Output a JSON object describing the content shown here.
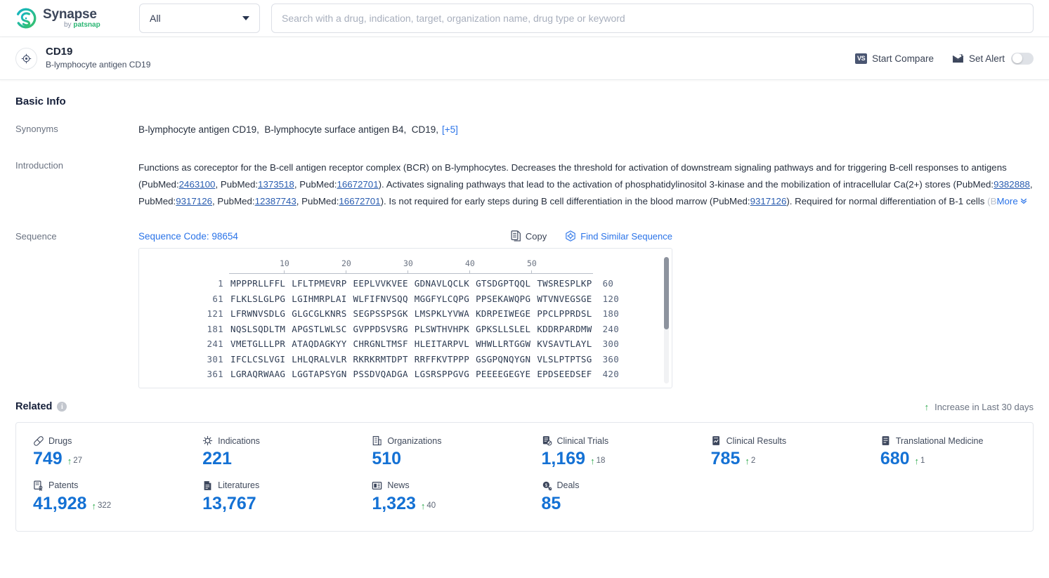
{
  "brand": {
    "name": "Synapse",
    "by_prefix": "by ",
    "by_name": "patsnap",
    "logo_icon": "synapse-circle-logo"
  },
  "search": {
    "scope_value": "All",
    "scope_caret_icon": "chevron-down-icon",
    "placeholder": "Search with a drug, indication, target, organization name, drug type or keyword",
    "value": ""
  },
  "entity": {
    "icon": "target-crosshair-icon",
    "name": "CD19",
    "alias": "B-lymphocyte antigen CD19",
    "actions": {
      "compare_badge": "VS",
      "compare_label": "Start Compare",
      "alert_icon": "alert-envelope-icon",
      "alert_label": "Set Alert",
      "alert_toggle_state": "off"
    }
  },
  "basic_info": {
    "title": "Basic Info",
    "synonyms": {
      "label": "Synonyms",
      "items": [
        "B-lymphocyte antigen CD19",
        "B-lymphocyte surface antigen B4",
        "CD19"
      ],
      "more": "[+5]"
    },
    "introduction": {
      "label": "Introduction",
      "text_1": "Functions as coreceptor for the B-cell antigen receptor complex (BCR) on B-lymphocytes. Decreases the threshold for activation of downstream signaling pathways and for triggering B-cell responses to antigens (PubMed:",
      "ref_1": "2463100",
      "text_2": ", PubMed:",
      "ref_2": "1373518",
      "text_3": ", PubMed:",
      "ref_3": "16672701",
      "text_4": "). Activates signaling pathways that lead to the activation of phosphatidylinositol 3-kinase and the mobilization of intracellular Ca(2+) stores (PubMed:",
      "ref_4": "9382888",
      "text_5": ", PubMed:",
      "ref_5": "9317126",
      "text_6": ", PubMed:",
      "ref_6": "12387743",
      "text_7": ", PubMed:",
      "ref_7": "16672701",
      "text_8": "). Is not required for early steps during B cell differentiation in the blood marrow (PubMed:",
      "ref_8": "9317126",
      "text_9": "). Required for normal differentiation of B-1 cells ",
      "text_fade": "(B",
      "more_label": "More",
      "more_icon": "double-chevron-down-icon"
    },
    "sequence": {
      "label": "Sequence",
      "code_label": "Sequence Code: 98654",
      "copy_icon": "copy-icon",
      "copy_label": "Copy",
      "find_icon": "find-similar-icon",
      "find_label": "Find Similar Sequence",
      "ruler_ticks": [
        "10",
        "20",
        "30",
        "40",
        "50"
      ],
      "rows": [
        {
          "start": "1",
          "chunks": [
            "MPPPRLLFFL",
            "LFLTPMEVRP",
            "EEPLVVKVEE",
            "GDNAVLQCLK",
            "GTSDGPTQQL",
            "TWSRESPLKP"
          ],
          "end": "60"
        },
        {
          "start": "61",
          "chunks": [
            "FLKLSLGLPG",
            "LGIHMRPLAI",
            "WLFIFNVSQQ",
            "MGGFYLCQPG",
            "PPSEKAWQPG",
            "WTVNVEGSGE"
          ],
          "end": "120"
        },
        {
          "start": "121",
          "chunks": [
            "LFRWNVSDLG",
            "GLGCGLKNRS",
            "SEGPSSPSGK",
            "LMSPKLYVWA",
            "KDRPEIWEGE",
            "PPCLPPRDSL"
          ],
          "end": "180"
        },
        {
          "start": "181",
          "chunks": [
            "NQSLSQDLTM",
            "APGSTLWLSC",
            "GVPPDSVSRG",
            "PLSWTHVHPK",
            "GPKSLLSLEL",
            "KDDRPARDMW"
          ],
          "end": "240"
        },
        {
          "start": "241",
          "chunks": [
            "VMETGLLLPR",
            "ATAQDAGKYY",
            "CHRGNLTMSF",
            "HLEITARPVL",
            "WHWLLRTGGW",
            "KVSAVTLAYL"
          ],
          "end": "300"
        },
        {
          "start": "301",
          "chunks": [
            "IFCLCSLVGI",
            "LHLQRALVLR",
            "RKRKRMTDPT",
            "RRFFKVTPPP",
            "GSGPQNQYGN",
            "VLSLPTPTSG"
          ],
          "end": "360"
        },
        {
          "start": "361",
          "chunks": [
            "LGRAQRWAAG",
            "LGGTAPSYGN",
            "PSSDVQADGA",
            "LGSRSPPGVG",
            "PEEEEGEGYE",
            "EPDSEEDSEF"
          ],
          "end": "420"
        }
      ]
    }
  },
  "related": {
    "title": "Related",
    "info_icon": "info-icon",
    "increase_arrow_icon": "up-arrow-icon",
    "increase_label": "Increase in Last 30 days",
    "stats": [
      {
        "icon": "pill-icon",
        "label": "Drugs",
        "value": "749",
        "delta": "27"
      },
      {
        "icon": "virus-icon",
        "label": "Indications",
        "value": "221",
        "delta": ""
      },
      {
        "icon": "building-icon",
        "label": "Organizations",
        "value": "510",
        "delta": ""
      },
      {
        "icon": "clinical-trial-icon",
        "label": "Clinical Trials",
        "value": "1,169",
        "delta": "18"
      },
      {
        "icon": "clinical-result-icon",
        "label": "Clinical Results",
        "value": "785",
        "delta": "2"
      },
      {
        "icon": "translational-icon",
        "label": "Translational Medicine",
        "value": "680",
        "delta": "1"
      },
      {
        "icon": "patent-icon",
        "label": "Patents",
        "value": "41,928",
        "delta": "322"
      },
      {
        "icon": "literature-icon",
        "label": "Literatures",
        "value": "13,767",
        "delta": ""
      },
      {
        "icon": "news-icon",
        "label": "News",
        "value": "1,323",
        "delta": "40"
      },
      {
        "icon": "deal-icon",
        "label": "Deals",
        "value": "85",
        "delta": ""
      }
    ]
  },
  "colors": {
    "accent_blue": "#1471d4",
    "link_blue": "#2a73e8",
    "green": "#2aa84a",
    "brand_teal": "#14b8c4",
    "brand_green": "#2bb673"
  }
}
